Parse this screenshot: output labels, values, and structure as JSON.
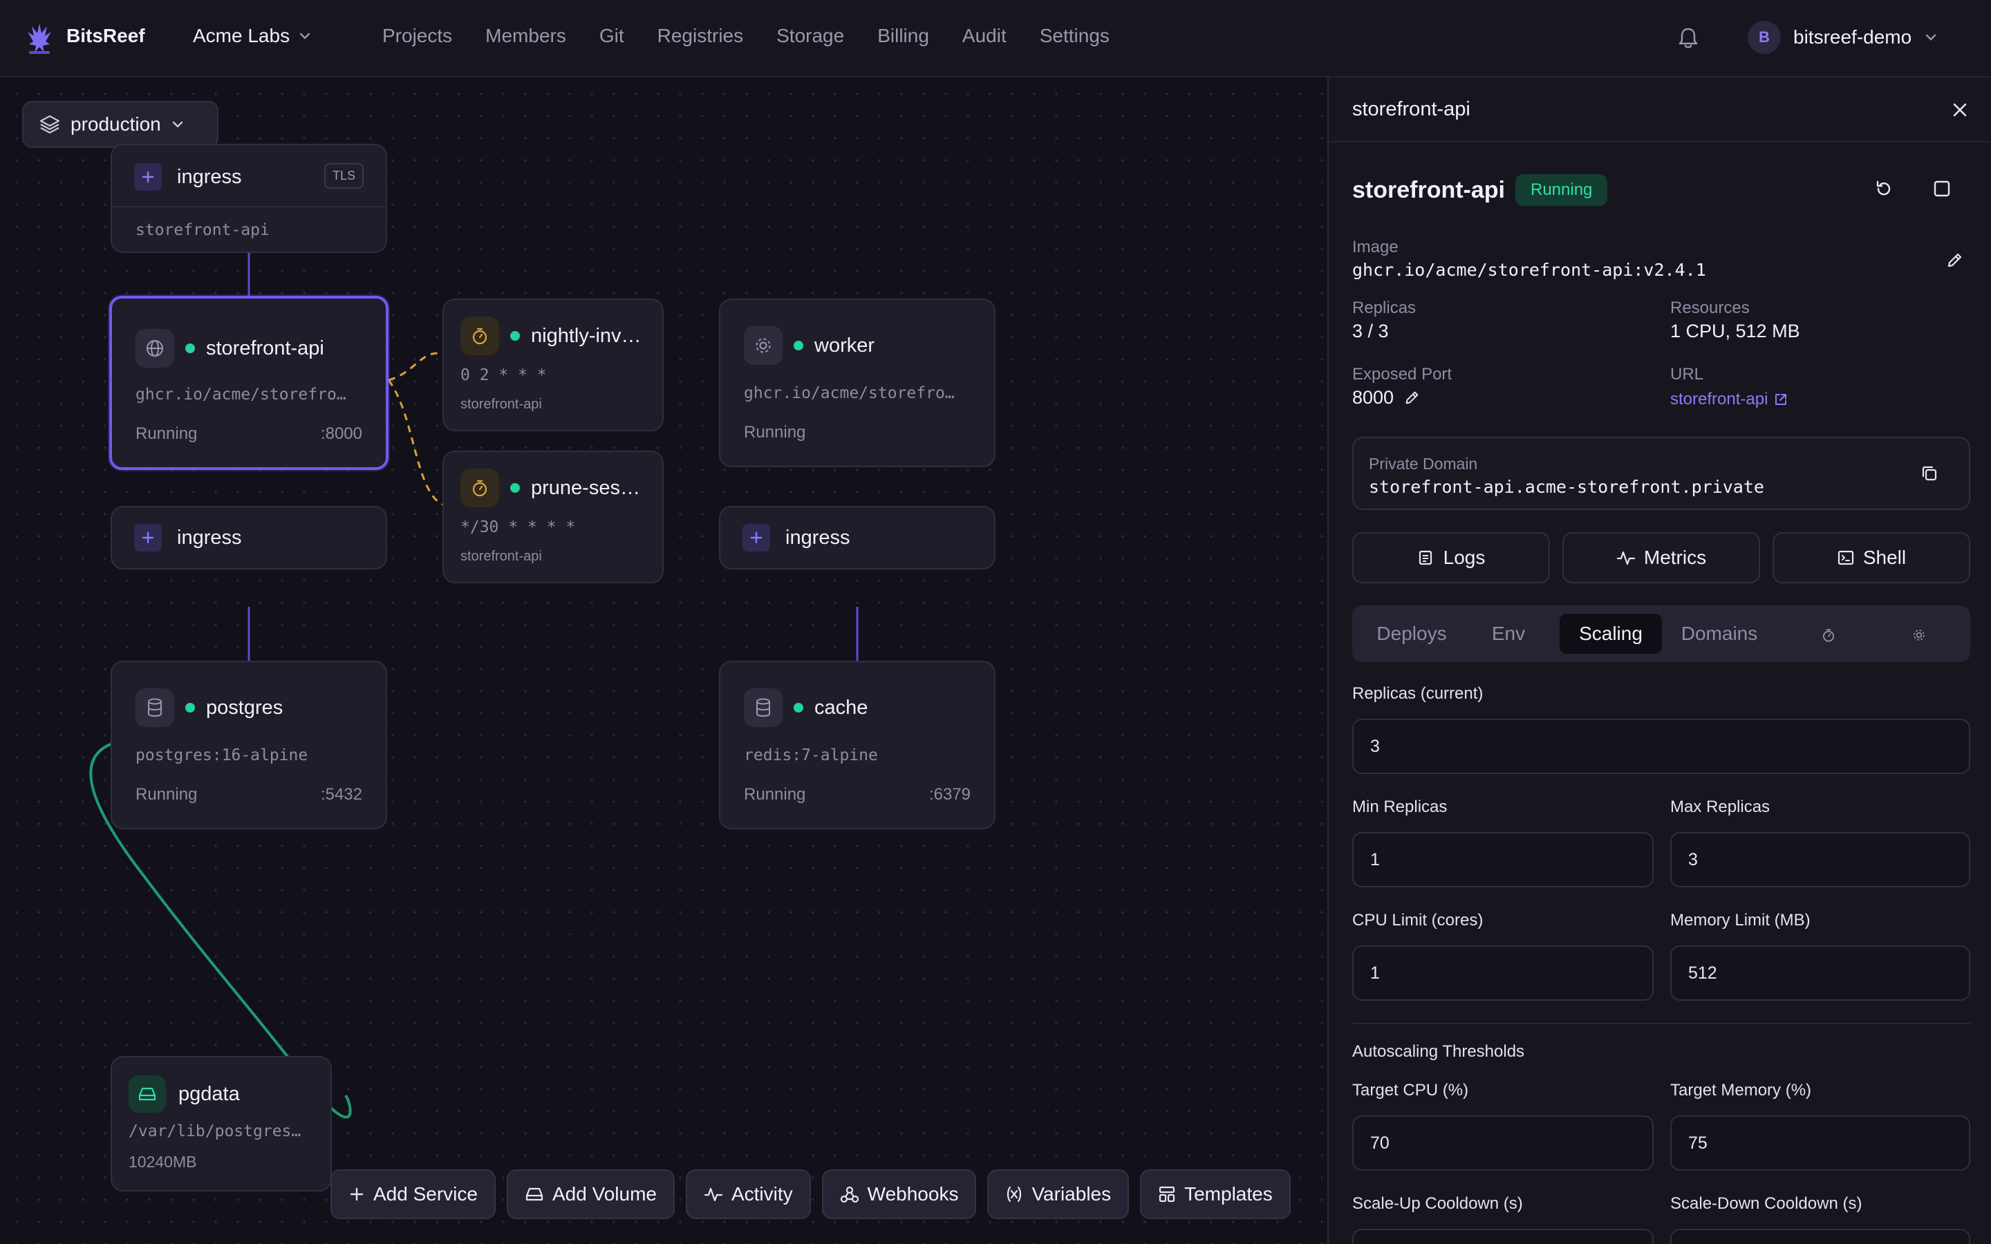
{
  "header": {
    "brand": "BitsReef",
    "org": "Acme Labs",
    "nav": [
      "Projects",
      "Members",
      "Git",
      "Registries",
      "Storage",
      "Billing",
      "Audit",
      "Settings"
    ],
    "user": {
      "initial": "B",
      "name": "bitsreef-demo"
    }
  },
  "canvas": {
    "environment": "production",
    "ingress_top": {
      "label": "ingress",
      "badge": "TLS",
      "target": "storefront-api"
    },
    "services": {
      "storefront": {
        "name": "storefront-api",
        "image": "ghcr.io/acme/storefro…",
        "status": "Running",
        "port": ":8000"
      },
      "worker": {
        "name": "worker",
        "image": "ghcr.io/acme/storefro…",
        "status": "Running"
      },
      "postgres": {
        "name": "postgres",
        "image": "postgres:16-alpine",
        "status": "Running",
        "port": ":5432"
      },
      "cache": {
        "name": "cache",
        "image": "redis:7-alpine",
        "status": "Running",
        "port": ":6379"
      }
    },
    "crons": {
      "nightly": {
        "name": "nightly-inv…",
        "schedule": "0 2 * * *",
        "target": "storefront-api"
      },
      "prune": {
        "name": "prune-ses…",
        "schedule": "*/30 * * * *",
        "target": "storefront-api"
      }
    },
    "ingress_storefront": {
      "label": "ingress"
    },
    "ingress_worker": {
      "label": "ingress"
    },
    "volume": {
      "name": "pgdata",
      "path": "/var/lib/postgres…",
      "size": "10240MB"
    },
    "toolbar": [
      "Add Service",
      "Add Volume",
      "Activity",
      "Webhooks",
      "Variables",
      "Templates"
    ]
  },
  "panel": {
    "title": "storefront-api",
    "service_name": "storefront-api",
    "status": "Running",
    "image_label": "Image",
    "image": "ghcr.io/acme/storefront-api:v2.4.1",
    "replicas_label": "Replicas",
    "replicas": "3 / 3",
    "resources_label": "Resources",
    "resources": "1 CPU, 512 MB",
    "port_label": "Exposed Port",
    "port": "8000",
    "url_label": "URL",
    "url": "storefront-api",
    "private_domain_label": "Private Domain",
    "private_domain": "storefront-api.acme-storefront.private",
    "actions": [
      "Logs",
      "Metrics",
      "Shell"
    ],
    "tabs": [
      "Deploys",
      "Env",
      "Scaling",
      "Domains"
    ],
    "active_tab": "Scaling",
    "scaling": {
      "replicas_current_label": "Replicas (current)",
      "replicas_current": "3",
      "min_label": "Min Replicas",
      "min": "1",
      "max_label": "Max Replicas",
      "max": "3",
      "cpu_label": "CPU Limit (cores)",
      "cpu": "1",
      "mem_label": "Memory Limit (MB)",
      "mem": "512",
      "autoscaling_label": "Autoscaling Thresholds",
      "target_cpu_label": "Target CPU (%)",
      "target_cpu": "70",
      "target_mem_label": "Target Memory (%)",
      "target_mem": "75",
      "up_cooldown_label": "Scale-Up Cooldown (s)",
      "down_cooldown_label": "Scale-Down Cooldown (s)"
    }
  },
  "colors": {
    "accent": "#6d5cf0",
    "running": "#22d39a",
    "cron": "#e0a93a",
    "link": "#8b7cf6"
  }
}
